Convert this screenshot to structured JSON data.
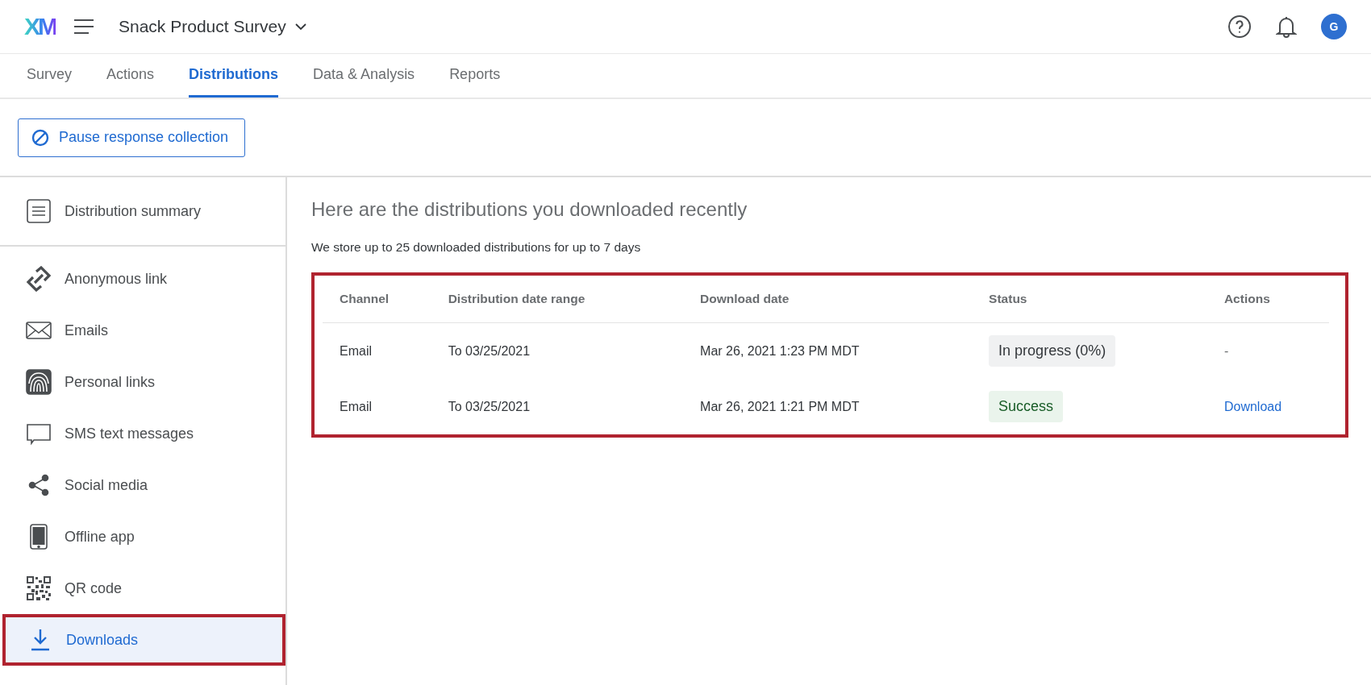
{
  "header": {
    "logo": "XM",
    "survey_title": "Snack Product Survey",
    "avatar": "G"
  },
  "tabs": [
    {
      "label": "Survey",
      "selected": false
    },
    {
      "label": "Actions",
      "selected": false
    },
    {
      "label": "Distributions",
      "selected": true
    },
    {
      "label": "Data & Analysis",
      "selected": false
    },
    {
      "label": "Reports",
      "selected": false
    }
  ],
  "pause_button": "Pause response collection",
  "sidebar": {
    "summary": {
      "kind": "summary",
      "label": "Distribution summary",
      "selected": false,
      "outlined": false
    },
    "items": [
      {
        "kind": "link",
        "label": "Anonymous link",
        "selected": false,
        "outlined": false
      },
      {
        "kind": "email",
        "label": "Emails",
        "selected": false,
        "outlined": false
      },
      {
        "kind": "fingerprint",
        "label": "Personal links",
        "selected": false,
        "outlined": false
      },
      {
        "kind": "sms",
        "label": "SMS text messages",
        "selected": false,
        "outlined": false
      },
      {
        "kind": "social",
        "label": "Social media",
        "selected": false,
        "outlined": false
      },
      {
        "kind": "phone",
        "label": "Offline app",
        "selected": false,
        "outlined": false
      },
      {
        "kind": "qr",
        "label": "QR code",
        "selected": false,
        "outlined": false
      },
      {
        "kind": "download",
        "label": "Downloads",
        "selected": true,
        "outlined": true
      }
    ]
  },
  "main": {
    "heading": "Here are the distributions you downloaded recently",
    "note": "We store up to 25 downloaded distributions for up to 7 days",
    "table": {
      "outlined": true,
      "columns": [
        "Channel",
        "Distribution date range",
        "Download date",
        "Status",
        "Actions"
      ],
      "rows": [
        {
          "channel": "Email",
          "range": "To 03/25/2021",
          "date": "Mar 26, 2021 1:23 PM MDT",
          "status": {
            "kind": "progress",
            "text": "In progress (0%)"
          },
          "action": {
            "kind": "none",
            "text": "-"
          }
        },
        {
          "channel": "Email",
          "range": "To 03/25/2021",
          "date": "Mar 26, 2021 1:21 PM MDT",
          "status": {
            "kind": "success",
            "text": "Success"
          },
          "action": {
            "kind": "link",
            "text": "Download"
          }
        }
      ]
    }
  }
}
